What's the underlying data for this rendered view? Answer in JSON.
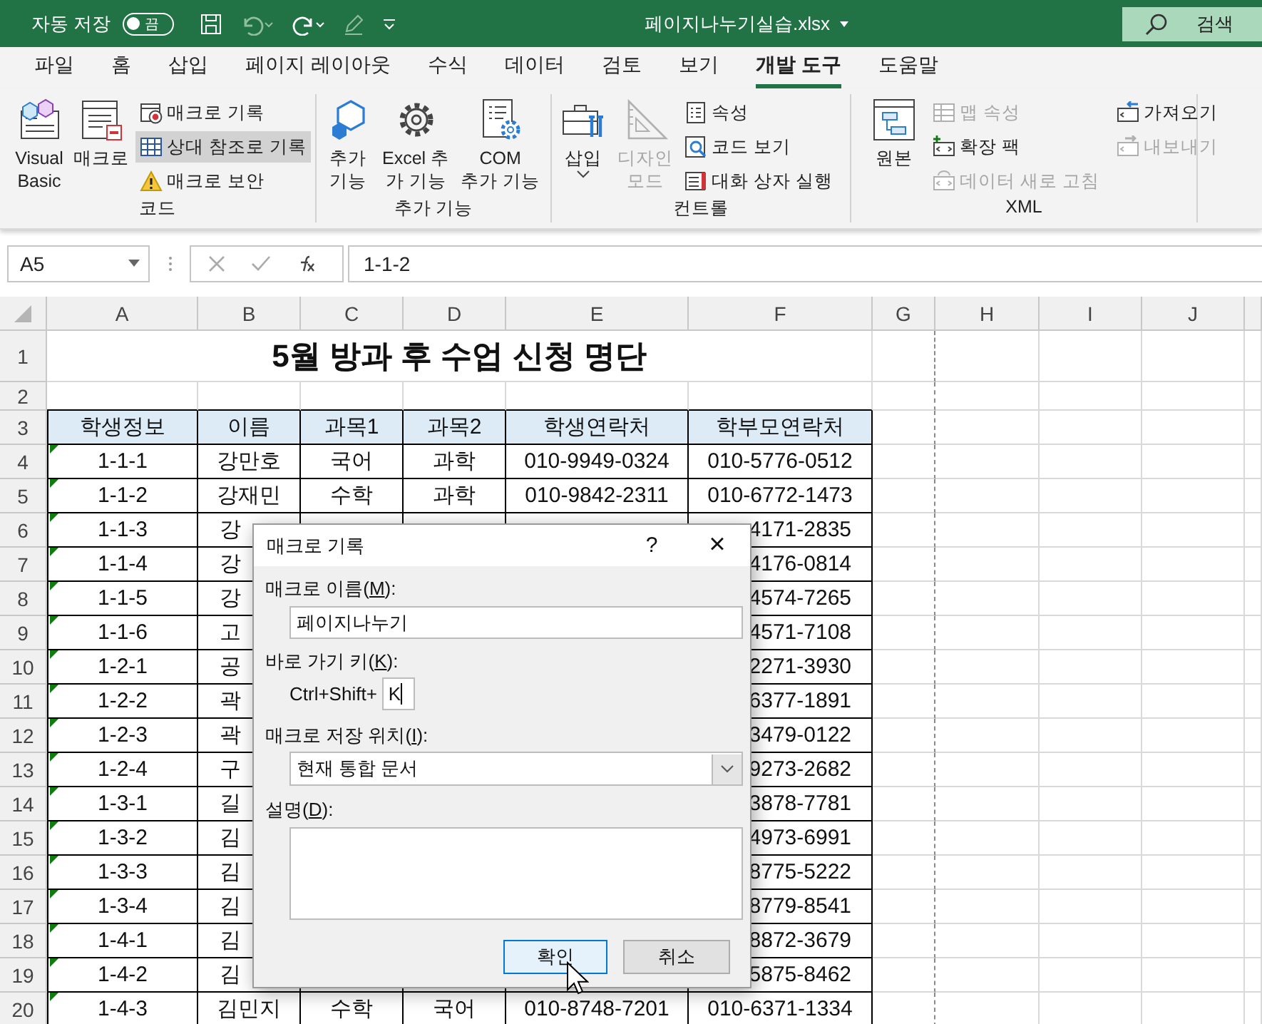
{
  "title_bar": {
    "autosave_label": "자동 저장",
    "autosave_toggle": {
      "label": "끔",
      "on": false
    },
    "file_name": "페이지나누기실습.xlsx",
    "search_placeholder": "검색"
  },
  "tabs": [
    {
      "label": "파일",
      "selected": false
    },
    {
      "label": "홈",
      "selected": false
    },
    {
      "label": "삽입",
      "selected": false
    },
    {
      "label": "페이지 레이아웃",
      "selected": false
    },
    {
      "label": "수식",
      "selected": false
    },
    {
      "label": "데이터",
      "selected": false
    },
    {
      "label": "검토",
      "selected": false
    },
    {
      "label": "보기",
      "selected": false
    },
    {
      "label": "개발 도구",
      "selected": true
    },
    {
      "label": "도움말",
      "selected": false
    }
  ],
  "ribbon": {
    "groups": [
      {
        "label": "코드",
        "items": [
          {
            "kind": "large",
            "label": "Visual\nBasic",
            "disabled": false,
            "pressed": false,
            "dropdown": false
          },
          {
            "kind": "large",
            "label": "매크로",
            "disabled": false,
            "pressed": false,
            "dropdown": false
          },
          {
            "kind": "small",
            "label": "매크로 기록",
            "disabled": false,
            "pressed": false,
            "dropdown": false
          },
          {
            "kind": "small",
            "label": "상대 참조로 기록",
            "disabled": false,
            "pressed": true,
            "dropdown": false
          },
          {
            "kind": "small",
            "label": "매크로 보안",
            "disabled": false,
            "pressed": false,
            "dropdown": false
          }
        ]
      },
      {
        "label": "추가 기능",
        "items": [
          {
            "kind": "large",
            "label": "추가\n기능",
            "disabled": false,
            "pressed": false,
            "dropdown": false
          },
          {
            "kind": "large",
            "label": "Excel 추\n가 기능",
            "disabled": false,
            "pressed": false,
            "dropdown": false
          },
          {
            "kind": "large",
            "label": "COM\n추가 기능",
            "disabled": false,
            "pressed": false,
            "dropdown": false
          }
        ]
      },
      {
        "label": "컨트롤",
        "items": [
          {
            "kind": "large",
            "label": "삽입",
            "disabled": false,
            "pressed": false,
            "dropdown": true
          },
          {
            "kind": "large",
            "label": "디자인\n모드",
            "disabled": true,
            "pressed": false,
            "dropdown": false
          },
          {
            "kind": "small",
            "label": "속성",
            "disabled": false,
            "pressed": false,
            "dropdown": false
          },
          {
            "kind": "small",
            "label": "코드 보기",
            "disabled": false,
            "pressed": false,
            "dropdown": false
          },
          {
            "kind": "small",
            "label": "대화 상자 실행",
            "disabled": false,
            "pressed": false,
            "dropdown": false
          }
        ]
      },
      {
        "label": "XML",
        "items": [
          {
            "kind": "large",
            "label": "원본",
            "disabled": false,
            "pressed": false,
            "dropdown": false
          },
          {
            "kind": "small",
            "label": "맵 속성",
            "disabled": true,
            "pressed": false,
            "dropdown": false
          },
          {
            "kind": "small",
            "label": "확장 팩",
            "disabled": false,
            "pressed": false,
            "dropdown": false
          },
          {
            "kind": "small",
            "label": "데이터 새로 고침",
            "disabled": true,
            "pressed": false,
            "dropdown": false
          },
          {
            "kind": "small",
            "label": "가져오기",
            "disabled": false,
            "pressed": false,
            "dropdown": false
          },
          {
            "kind": "small",
            "label": "내보내기",
            "disabled": true,
            "pressed": false,
            "dropdown": false
          }
        ]
      }
    ]
  },
  "formula_bar": {
    "name_box": "A5",
    "formula": "1-1-2"
  },
  "sheet": {
    "columns": [
      "A",
      "B",
      "C",
      "D",
      "E",
      "F",
      "G",
      "H",
      "I",
      "J"
    ],
    "row_numbers": [
      "1",
      "2",
      "3",
      "4",
      "5",
      "6",
      "7",
      "8",
      "9",
      "10",
      "11",
      "12",
      "13",
      "14",
      "15",
      "16",
      "17",
      "18",
      "19",
      "20"
    ],
    "title": "5월 방과 후 수업 신청 명단",
    "header": [
      "학생정보",
      "이름",
      "과목1",
      "과목2",
      "학생연락처",
      "학부모연락처"
    ],
    "rows": [
      {
        "student_id": "1-1-1",
        "name": "강만호",
        "subject_1": "국어",
        "subject_2": "과학",
        "student_phone": "010-9949-0324",
        "parent_phone": "010-5776-0512"
      },
      {
        "student_id": "1-1-2",
        "name": "강재민",
        "subject_1": "수학",
        "subject_2": "과학",
        "student_phone": "010-9842-2311",
        "parent_phone": "010-6772-1473"
      },
      {
        "student_id": "1-1-3",
        "name": "강",
        "parent_phone": "4171-2835"
      },
      {
        "student_id": "1-1-4",
        "name": "강",
        "parent_phone": "4176-0814"
      },
      {
        "student_id": "1-1-5",
        "name": "강",
        "parent_phone": "4574-7265"
      },
      {
        "student_id": "1-1-6",
        "name": "고",
        "parent_phone": "4571-7108"
      },
      {
        "student_id": "1-2-1",
        "name": "공",
        "parent_phone": "2271-3930"
      },
      {
        "student_id": "1-2-2",
        "name": "곽",
        "parent_phone": "6377-1891"
      },
      {
        "student_id": "1-2-3",
        "name": "곽",
        "parent_phone": "3479-0122"
      },
      {
        "student_id": "1-2-4",
        "name": "구",
        "parent_phone": "9273-2682"
      },
      {
        "student_id": "1-3-1",
        "name": "길",
        "parent_phone": "3878-7781"
      },
      {
        "student_id": "1-3-2",
        "name": "김",
        "parent_phone": "4973-6991"
      },
      {
        "student_id": "1-3-3",
        "name": "김",
        "parent_phone": "8775-5222"
      },
      {
        "student_id": "1-3-4",
        "name": "김",
        "parent_phone": "8779-8541"
      },
      {
        "student_id": "1-4-1",
        "name": "김",
        "parent_phone": "8872-3679"
      },
      {
        "student_id": "1-4-2",
        "name": "김",
        "parent_phone": "5875-8462"
      },
      {
        "student_id": "1-4-3",
        "name": "김민지",
        "subject_1": "수학",
        "subject_2": "국어",
        "student_phone": "010-8748-7201",
        "parent_phone": "010-6371-1334"
      }
    ]
  },
  "dialog": {
    "title": "매크로 기록",
    "help_button": "?",
    "close_button": "×",
    "name_label": {
      "before": "매크로 이름(",
      "key": "M",
      "after": "):"
    },
    "name_value": "페이지나누기",
    "shortcut_label": {
      "before": "바로 가기 키(",
      "key": "K",
      "after": "):"
    },
    "shortcut_prefix": "Ctrl+Shift+",
    "shortcut_value": "K",
    "store_label": {
      "before": "매크로 저장 위치(",
      "key": "I",
      "after": "):"
    },
    "store_value": "현재 통합 문서",
    "description_label": {
      "before": "설명(",
      "key": "D",
      "after": "):"
    },
    "buttons": [
      {
        "label": "확인",
        "default": true
      },
      {
        "label": "취소",
        "default": false
      }
    ]
  }
}
